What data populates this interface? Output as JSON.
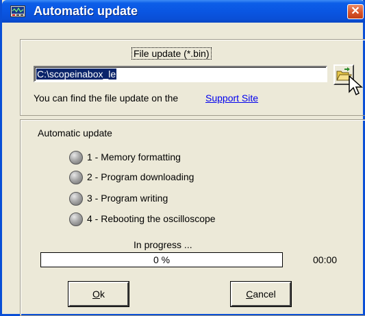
{
  "window": {
    "title": "Automatic update",
    "close_glyph": "✕"
  },
  "file_update": {
    "caption": "File update (*.bin)",
    "path_value": "C:\\scopeinabox_le",
    "hint_text": "You can find the file update on the ",
    "link_text": "Support Site"
  },
  "automatic_update": {
    "caption": "Automatic update",
    "steps": [
      {
        "label": "1 - Memory formatting"
      },
      {
        "label": "2 - Program downloading"
      },
      {
        "label": "3 - Program writing"
      },
      {
        "label": "4 - Rebooting the oscilloscope"
      }
    ],
    "progress_caption": "In progress ...",
    "progress_text": "0 %",
    "progress_fraction": 0,
    "timer": "00:00"
  },
  "buttons": {
    "ok_mnemonic": "O",
    "ok_rest": "k",
    "cancel_mnemonic": "C",
    "cancel_rest": "ancel"
  },
  "colors": {
    "titlebar": "#0a4fd6",
    "link": "#0000ee",
    "selection": "#0a246a"
  },
  "icons": [
    "app-icon",
    "folder-open-icon",
    "mouse-pointer-icon",
    "close-icon"
  ]
}
